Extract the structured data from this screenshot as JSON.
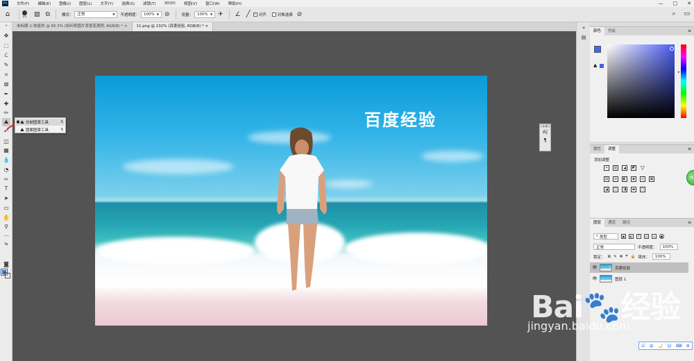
{
  "menubar": {
    "app_logo": "Ps",
    "items": [
      "文件(F)",
      "编辑(E)",
      "图像(I)",
      "图层(L)",
      "文字(Y)",
      "选择(S)",
      "滤镜(T)",
      "3D(D)",
      "视图(V)",
      "窗口(W)",
      "帮助(H)"
    ],
    "window_controls": [
      "—",
      "□",
      "✕"
    ]
  },
  "options": {
    "brush_size": "21",
    "mode_label": "模式：",
    "mode_value": "正常",
    "opacity_label": "不透明度：",
    "opacity_value": "100%",
    "flow_label": "流量：",
    "flow_value": "100%",
    "aligned_label": "对齐",
    "sample_all_label": "对象选择",
    "icons": [
      "home-icon",
      "brush-preset-icon",
      "clone-source-icon",
      "pressure-opacity-icon",
      "airbrush-icon",
      "angle-icon",
      "ignore-adjustment-icon",
      "search-icon",
      "workspace-icon"
    ]
  },
  "tabs": [
    {
      "label": "未标题-1-恢复的 @ 65.3% (如何将图片背景变透明, RGB/8) *",
      "active": false,
      "close": "×"
    },
    {
      "label": "11.png @ 132% (百度经验, RGB/8) *",
      "active": true,
      "close": "×"
    }
  ],
  "flyout": {
    "items": [
      {
        "label": "仿制图章工具",
        "shortcut": "S",
        "selected": true
      },
      {
        "label": "图案图章工具",
        "shortcut": "S",
        "selected": false
      }
    ]
  },
  "canvas": {
    "text_layer": "百度经验"
  },
  "mini_panel": {
    "items": [
      "A|",
      "¶"
    ]
  },
  "color_panel": {
    "tabs": [
      "颜色",
      "色板"
    ],
    "foreground": "#3b6cf6",
    "background": "#ffffff"
  },
  "adjust_panel": {
    "tabs": [
      "属性",
      "调整"
    ],
    "title": "添加调整"
  },
  "layers_panel": {
    "tabs": [
      "图层",
      "通道",
      "路径"
    ],
    "filter_kind": "类型",
    "blend_mode": "正常",
    "opacity_label": "不透明度：",
    "opacity_value": "100%",
    "lock_label": "锁定：",
    "fill_label": "填充：",
    "fill_value": "100%",
    "layers": [
      {
        "name": "百度经验",
        "visible": true,
        "selected": true
      },
      {
        "name": "图层 1",
        "visible": true,
        "selected": false
      }
    ]
  },
  "badge": {
    "text": "76"
  },
  "watermark": {
    "logo": "Bai🐾经验",
    "url": "jingyan.baidu.com"
  },
  "ime": {
    "items": [
      "☑",
      "中",
      "🌙",
      "☺",
      "⌨",
      "⚙"
    ]
  }
}
